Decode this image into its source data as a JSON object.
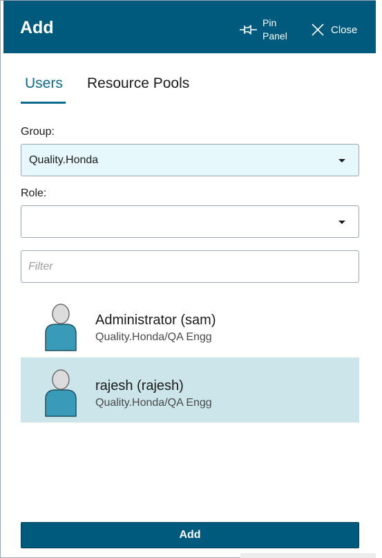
{
  "header": {
    "title": "Add",
    "pin_label": "Pin Panel",
    "close_label": "Close"
  },
  "tabs": [
    {
      "label": "Users",
      "active": true
    },
    {
      "label": "Resource Pools",
      "active": false
    }
  ],
  "form": {
    "group_label": "Group:",
    "group_value": "Quality.Honda",
    "role_label": "Role:",
    "role_value": "",
    "filter_placeholder": "Filter",
    "filter_value": ""
  },
  "users": [
    {
      "name": "Administrator (sam)",
      "group": "Quality.Honda/QA Engg",
      "selected": false
    },
    {
      "name": "rajesh (rajesh)",
      "group": "Quality.Honda/QA Engg",
      "selected": true
    }
  ],
  "footer": {
    "add_label": "Add"
  },
  "colors": {
    "header_bg": "#005a7d",
    "accent": "#0a6b8f",
    "selected_row": "#cbe5ea",
    "group_select_bg": "#e6f8fc",
    "avatar_body": "#3a9bb8"
  }
}
